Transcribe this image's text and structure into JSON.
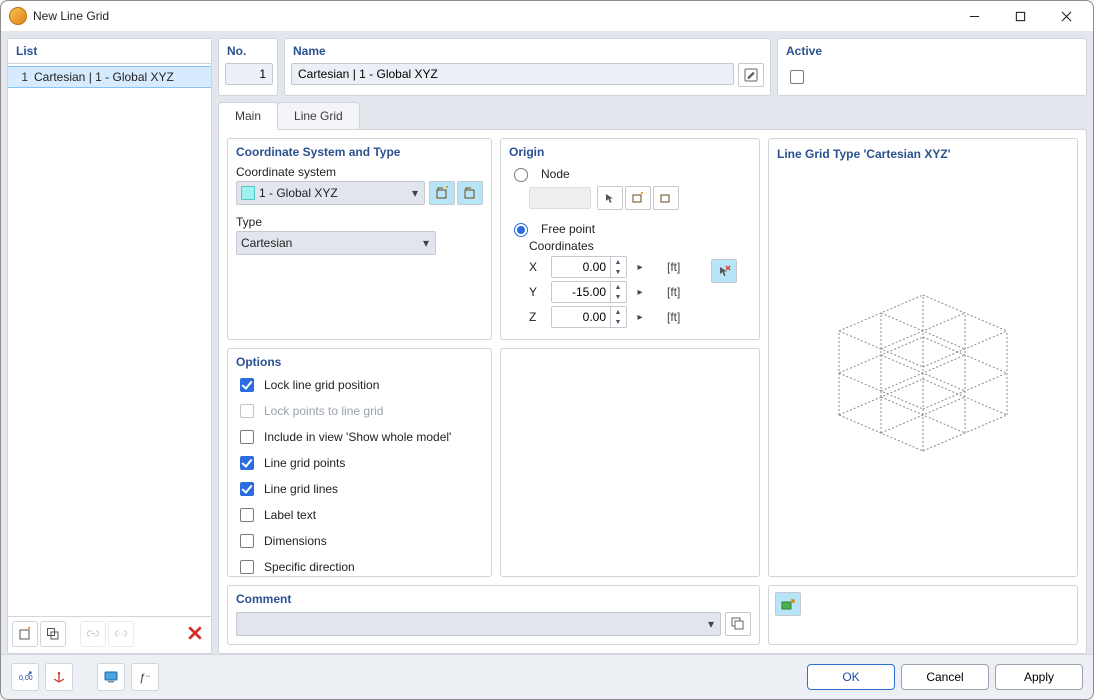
{
  "window": {
    "title": "New Line Grid"
  },
  "sidebar": {
    "header": "List",
    "items": [
      {
        "index": "1",
        "label": "Cartesian | 1 - Global XYZ"
      }
    ]
  },
  "header_panels": {
    "no_label": "No.",
    "no_value": "1",
    "name_label": "Name",
    "name_value": "Cartesian | 1 - Global XYZ",
    "active_label": "Active"
  },
  "tabs": {
    "main": "Main",
    "line_grid": "Line Grid"
  },
  "coord_section": {
    "title": "Coordinate System and Type",
    "cs_label": "Coordinate system",
    "cs_value": "1 - Global XYZ",
    "type_label": "Type",
    "type_value": "Cartesian"
  },
  "origin": {
    "title": "Origin",
    "node_label": "Node",
    "free_point_label": "Free point",
    "coord_label": "Coordinates",
    "rows": [
      {
        "axis": "X",
        "value": "0.00",
        "unit": "[ft]"
      },
      {
        "axis": "Y",
        "value": "-15.00",
        "unit": "[ft]"
      },
      {
        "axis": "Z",
        "value": "0.00",
        "unit": "[ft]"
      }
    ]
  },
  "options": {
    "title": "Options",
    "items": [
      {
        "label": "Lock line grid position",
        "checked": true
      },
      {
        "label": "Lock points to line grid",
        "checked": false,
        "disabled": true
      },
      {
        "label": "Include in view 'Show whole model'",
        "checked": false
      },
      {
        "label": "Line grid points",
        "checked": true
      },
      {
        "label": "Line grid lines",
        "checked": true
      },
      {
        "label": "Label text",
        "checked": false
      },
      {
        "label": "Dimensions",
        "checked": false
      },
      {
        "label": "Specific direction",
        "checked": false
      }
    ]
  },
  "comment": {
    "title": "Comment",
    "value": ""
  },
  "preview": {
    "title": "Line Grid Type 'Cartesian XYZ'"
  },
  "buttons": {
    "ok": "OK",
    "cancel": "Cancel",
    "apply": "Apply"
  }
}
